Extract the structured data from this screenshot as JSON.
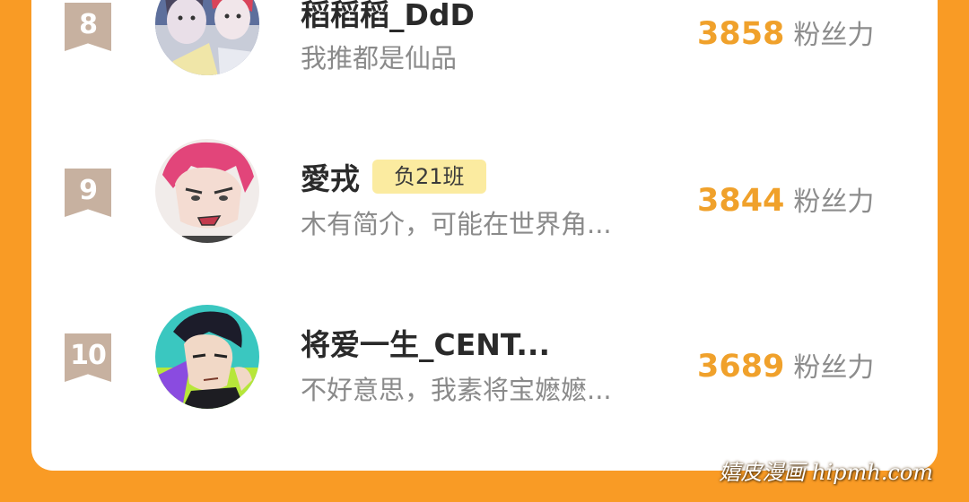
{
  "ranking": {
    "rows": [
      {
        "rank": "8",
        "name": "稻稻稻_DdD",
        "badge": "",
        "bio": "我推都是仙品",
        "fans_count": "3858",
        "fans_label": "粉丝力"
      },
      {
        "rank": "9",
        "name": "愛戎",
        "badge": "负21班",
        "bio": "木有简介，可能在世界角...",
        "fans_count": "3844",
        "fans_label": "粉丝力"
      },
      {
        "rank": "10",
        "name": "将爱一生_CENT...",
        "badge": "",
        "bio": "不好意思，我素将宝嬷嬷...",
        "fans_count": "3689",
        "fans_label": "粉丝力"
      }
    ]
  },
  "watermark": "嬉皮漫画 hipmh.com",
  "colors": {
    "background": "#f99b25",
    "card": "#ffffff",
    "fans_count": "#f0a12b",
    "rank_ribbon": "#c7b1a0",
    "badge": "#fbeba0"
  }
}
